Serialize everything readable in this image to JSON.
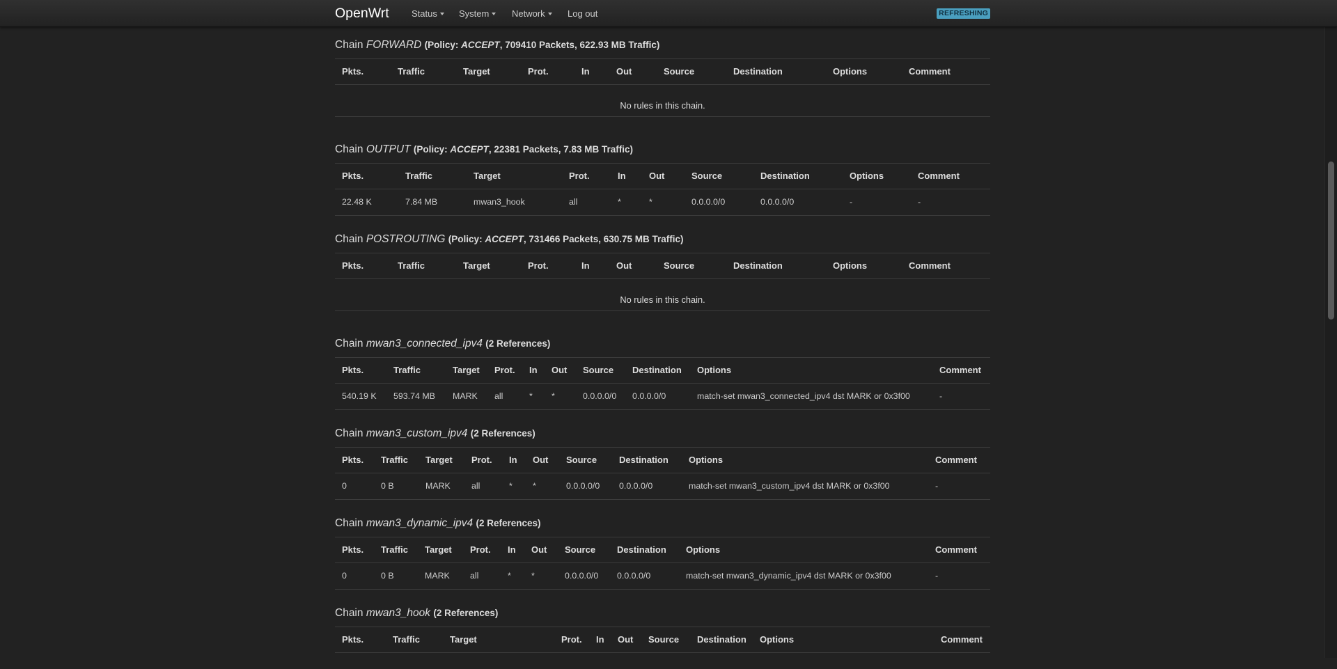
{
  "header": {
    "brand": "OpenWrt",
    "menu": [
      "Status",
      "System",
      "Network"
    ],
    "logout": "Log out",
    "badge": "REFRESHING"
  },
  "chains": [
    {
      "name": "FORWARD",
      "policy_label": "Policy:",
      "policy": "ACCEPT",
      "stats": "709410 Packets, 622.93 MB Traffic",
      "columns": [
        "Pkts.",
        "Traffic",
        "Target",
        "Prot.",
        "In",
        "Out",
        "Source",
        "Destination",
        "Options",
        "Comment"
      ],
      "rows": [],
      "empty_text": "No rules in this chain."
    },
    {
      "name": "OUTPUT",
      "policy_label": "Policy:",
      "policy": "ACCEPT",
      "stats": "22381 Packets, 7.83 MB Traffic",
      "columns": [
        "Pkts.",
        "Traffic",
        "Target",
        "Prot.",
        "In",
        "Out",
        "Source",
        "Destination",
        "Options",
        "Comment"
      ],
      "rows": [
        [
          "22.48 K",
          "7.84 MB",
          "mwan3_hook",
          "all",
          "*",
          "*",
          "0.0.0.0/0",
          "0.0.0.0/0",
          "-",
          "-"
        ]
      ]
    },
    {
      "name": "POSTROUTING",
      "policy_label": "Policy:",
      "policy": "ACCEPT",
      "stats": "731466 Packets, 630.75 MB Traffic",
      "columns": [
        "Pkts.",
        "Traffic",
        "Target",
        "Prot.",
        "In",
        "Out",
        "Source",
        "Destination",
        "Options",
        "Comment"
      ],
      "rows": [],
      "empty_text": "No rules in this chain."
    },
    {
      "name": "mwan3_connected_ipv4",
      "refs": "2 References",
      "columns": [
        "Pkts.",
        "Traffic",
        "Target",
        "Prot.",
        "In",
        "Out",
        "Source",
        "Destination",
        "Options",
        "Comment"
      ],
      "rows": [
        [
          "540.19 K",
          "593.74 MB",
          "MARK",
          "all",
          "*",
          "*",
          "0.0.0.0/0",
          "0.0.0.0/0",
          "match-set mwan3_connected_ipv4 dst MARK or 0x3f00",
          "-"
        ]
      ]
    },
    {
      "name": "mwan3_custom_ipv4",
      "refs": "2 References",
      "columns": [
        "Pkts.",
        "Traffic",
        "Target",
        "Prot.",
        "In",
        "Out",
        "Source",
        "Destination",
        "Options",
        "Comment"
      ],
      "rows": [
        [
          "0",
          "0 B",
          "MARK",
          "all",
          "*",
          "*",
          "0.0.0.0/0",
          "0.0.0.0/0",
          "match-set mwan3_custom_ipv4 dst MARK or 0x3f00",
          "-"
        ]
      ]
    },
    {
      "name": "mwan3_dynamic_ipv4",
      "refs": "2 References",
      "columns": [
        "Pkts.",
        "Traffic",
        "Target",
        "Prot.",
        "In",
        "Out",
        "Source",
        "Destination",
        "Options",
        "Comment"
      ],
      "rows": [
        [
          "0",
          "0 B",
          "MARK",
          "all",
          "*",
          "*",
          "0.0.0.0/0",
          "0.0.0.0/0",
          "match-set mwan3_dynamic_ipv4 dst MARK or 0x3f00",
          "-"
        ]
      ]
    },
    {
      "name": "mwan3_hook",
      "refs": "2 References",
      "columns": [
        "Pkts.",
        "Traffic",
        "Target",
        "Prot.",
        "In",
        "Out",
        "Source",
        "Destination",
        "Options",
        "Comment"
      ],
      "rows": []
    }
  ]
}
